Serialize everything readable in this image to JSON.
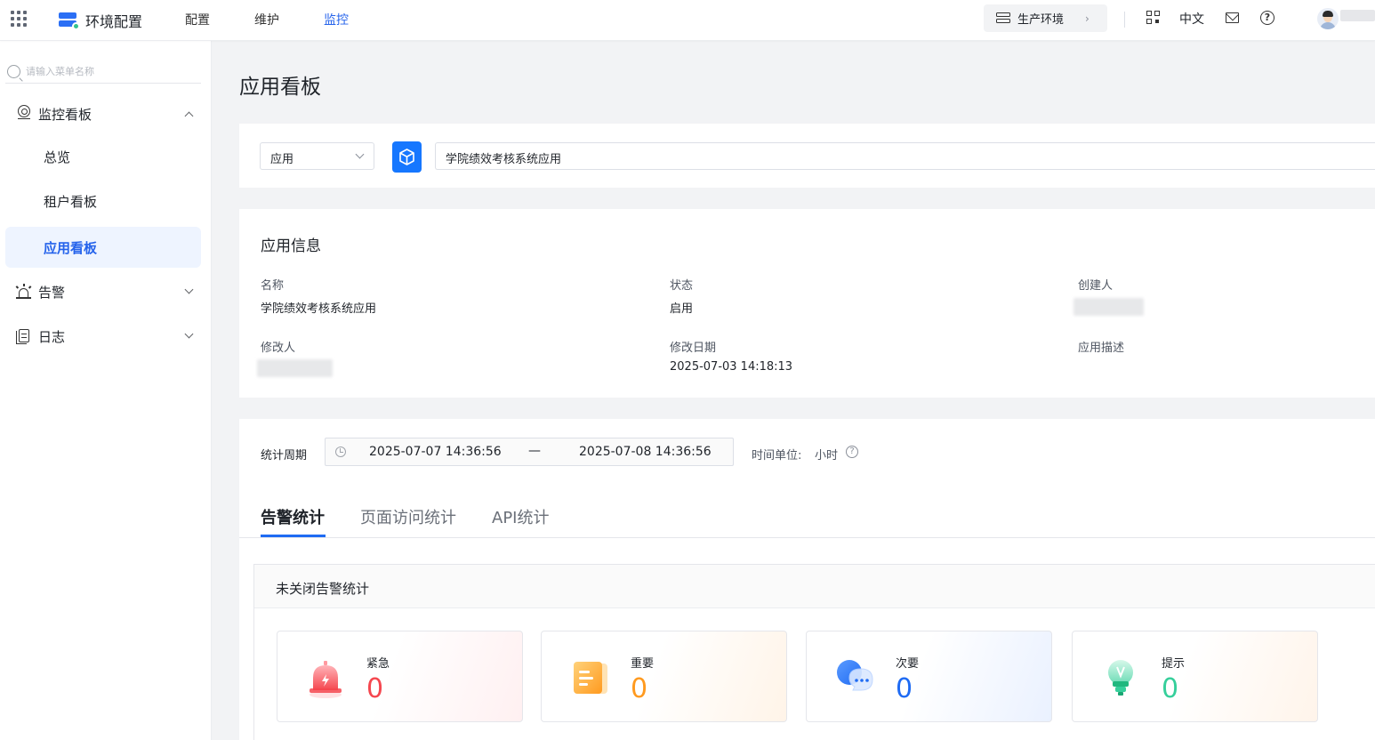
{
  "topbar": {
    "brand_title": "环境配置",
    "nav": [
      "配置",
      "维护",
      "监控"
    ],
    "active_nav": "监控",
    "env_label": "生产环境",
    "language": "中文",
    "accent_color": "#2563eb"
  },
  "sidebar": {
    "search_placeholder": "请输入菜单名称",
    "groups": [
      {
        "label": "监控看板",
        "icon": "monitor-icon",
        "expanded": true,
        "items": [
          "总览",
          "租户看板",
          "应用看板"
        ],
        "active_item": "应用看板"
      },
      {
        "label": "告警",
        "icon": "alarm-icon",
        "expanded": false
      },
      {
        "label": "日志",
        "icon": "log-icon",
        "expanded": false
      }
    ]
  },
  "main": {
    "page_title": "应用看板",
    "selector": {
      "type_value": "应用",
      "app_value": "学院绩效考核系统应用"
    },
    "info": {
      "title": "应用信息",
      "fields": {
        "name_label": "名称",
        "name_value": "学院绩效考核系统应用",
        "status_label": "状态",
        "status_value": "启用",
        "creator_label": "创建人",
        "modifier_label": "修改人",
        "modified_date_label": "修改日期",
        "modified_date_value": "2025-07-03 14:18:13",
        "description_label": "应用描述"
      }
    },
    "stats": {
      "period_label": "统计周期",
      "start": "2025-07-07 14:36:56",
      "separator": "—",
      "end": "2025-07-08 14:36:56",
      "unit_label": "时间单位:",
      "unit_value": "小时",
      "tabs": [
        "告警统计",
        "页面访问统计",
        "API统计"
      ],
      "active_tab": "告警统计",
      "panel_title": "未关闭告警统计",
      "cards": [
        {
          "label": "紧急",
          "value": "0",
          "color": "#f5474f",
          "icon": "bell-icon"
        },
        {
          "label": "重要",
          "value": "0",
          "color": "#ff9a1f",
          "icon": "document-icon"
        },
        {
          "label": "次要",
          "value": "0",
          "color": "#1f6bf3",
          "icon": "chat-bubble-icon"
        },
        {
          "label": "提示",
          "value": "0",
          "color": "#36cf9b",
          "icon": "lightbulb-icon"
        }
      ]
    }
  }
}
